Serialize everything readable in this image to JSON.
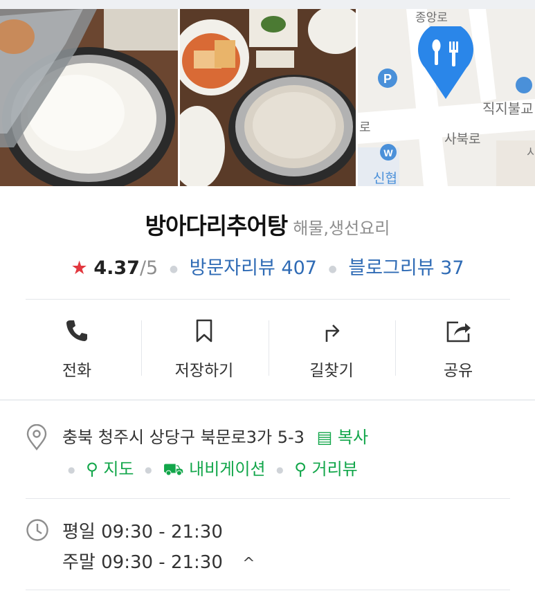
{
  "photos": [
    {
      "alt": "rice in stone pot"
    },
    {
      "alt": "side dishes and grain rice"
    }
  ],
  "map": {
    "labels": {
      "top_road": "종앙로",
      "right_school": "직지불교",
      "road_left": "로",
      "road_mid": "사북로",
      "bottom_left": "신협",
      "right_edge": "시"
    },
    "pin_color": "#2a86e9",
    "pin_icon": "restaurant-icon"
  },
  "place": {
    "name": "방아다리추어탕",
    "category": "해물,생선요리",
    "rating": "4.37",
    "rating_max": "/5",
    "visitor_reviews": "방문자리뷰 407",
    "blog_reviews": "블로그리뷰 37"
  },
  "actions": [
    {
      "label": "전화",
      "icon": "phone-icon"
    },
    {
      "label": "저장하기",
      "icon": "bookmark-icon"
    },
    {
      "label": "길찾기",
      "icon": "directions-icon"
    },
    {
      "label": "공유",
      "icon": "share-icon"
    }
  ],
  "address": {
    "text": "충북 청주시 상당구 북문로3가 5-3",
    "copy": "복사",
    "map": "지도",
    "navigation": "내비게이션",
    "street_view": "거리뷰"
  },
  "hours": {
    "weekday": "평일 09:30 - 21:30",
    "weekend": "주말 09:30 - 21:30",
    "toggle": "^"
  },
  "colors": {
    "accent_green": "#12a64a",
    "link_blue": "#2f6bb5",
    "star_red": "#e2383f"
  }
}
